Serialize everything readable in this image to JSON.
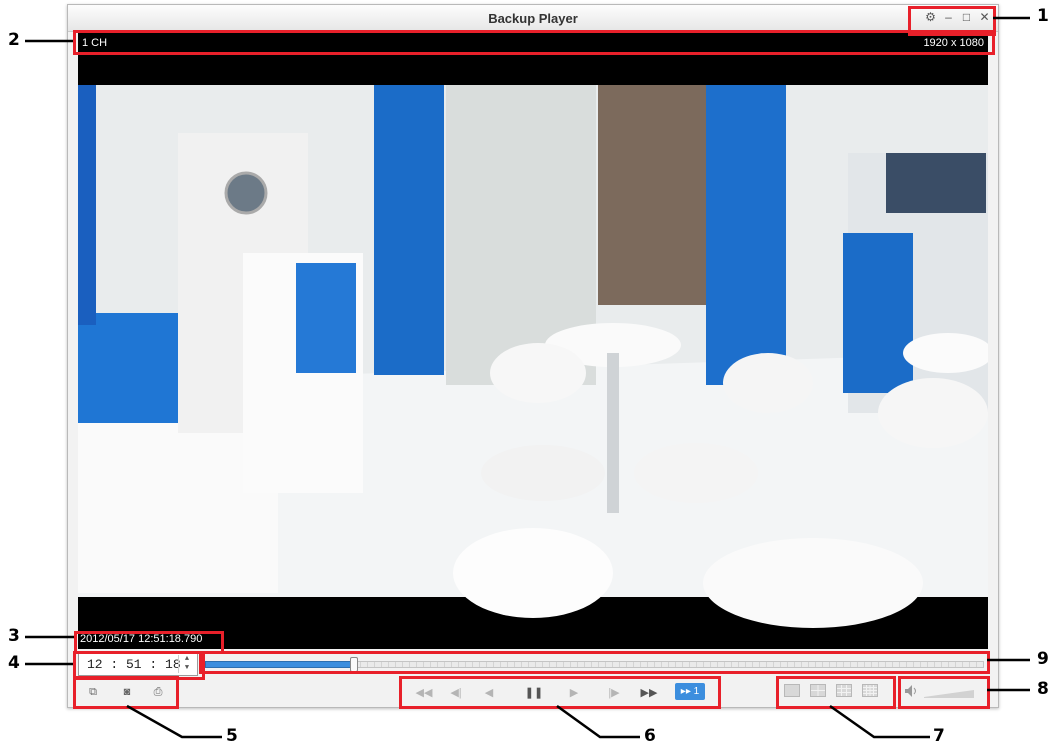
{
  "window": {
    "title": "Backup Player"
  },
  "window_controls": {
    "settings": "⚙",
    "minimize": "–",
    "maximize": "□",
    "close": "✕"
  },
  "info": {
    "channel": "1 CH",
    "resolution": "1920 x 1080"
  },
  "timestamp": "2012/05/17 12:51:18.790",
  "time_input": {
    "value": "12 : 51 : 18"
  },
  "timeline": {
    "position_percent": 19
  },
  "toolbar_left": [
    {
      "name": "backup-icon",
      "glyph": "⧉"
    },
    {
      "name": "snapshot-icon",
      "glyph": "◙"
    },
    {
      "name": "print-icon",
      "glyph": "⎙"
    }
  ],
  "playback": {
    "fast_rewind": "◀◀",
    "prev_frame": "◀|",
    "rewind": "◀",
    "pause": "❚❚",
    "play": "▶",
    "next_frame": "|▶",
    "fast_forward": "▶▶",
    "speed": "▸▸ 1"
  },
  "layouts": [
    "1x1",
    "2x2",
    "3x3",
    "4x4"
  ],
  "volume": {
    "level_percent": 0
  },
  "annotations": [
    "1",
    "2",
    "3",
    "4",
    "5",
    "6",
    "7",
    "8",
    "9"
  ],
  "colors": {
    "accent": "#3c8ede",
    "annotation": "#e8202a"
  }
}
